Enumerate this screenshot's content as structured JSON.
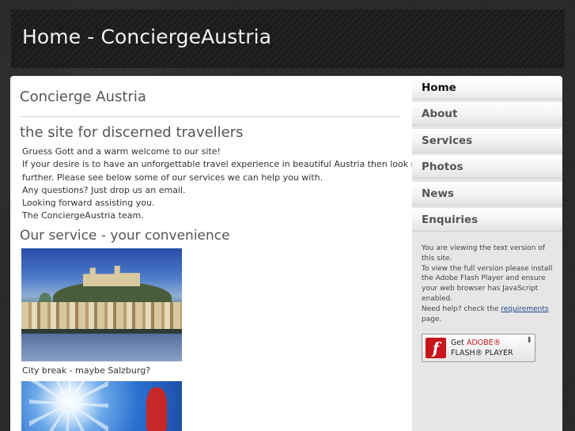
{
  "header": {
    "title": "Home - ConciergeAustria"
  },
  "main": {
    "heading": "Concierge Austria",
    "tagline": "the site for discerned travellers",
    "intro_lines": [
      "Gruess Gott and a warm welcome to our site!",
      "If your desire is to have an unforgettable travel experience in beautiful Austria then look no",
      "further. Please see below some of our services we can help you with.",
      "Any questions? Just drop us an email.",
      "Looking forward assisting you.",
      "The ConciergeAustria team."
    ],
    "section_heading": "Our service - your convenience",
    "photo_caption": "City break - maybe Salzburg?"
  },
  "sidebar": {
    "nav": [
      {
        "label": "Home",
        "active": true
      },
      {
        "label": "About",
        "active": false
      },
      {
        "label": "Services",
        "active": false
      },
      {
        "label": "Photos",
        "active": false
      },
      {
        "label": "News",
        "active": false
      },
      {
        "label": "Enquiries",
        "active": false
      }
    ],
    "notice": {
      "line1": "You are viewing the text version of this site.",
      "line2": "To view the full version please install the Adobe Flash Player and ensure your web browser has JavaScript enabled.",
      "help_prefix": "Need help? check the",
      "help_link": "requirements",
      "help_suffix": "page."
    },
    "flash_badge": {
      "get": "Get",
      "adobe": "ADOBE®",
      "player": "FLASH® PLAYER",
      "icon_glyph": "f"
    }
  }
}
